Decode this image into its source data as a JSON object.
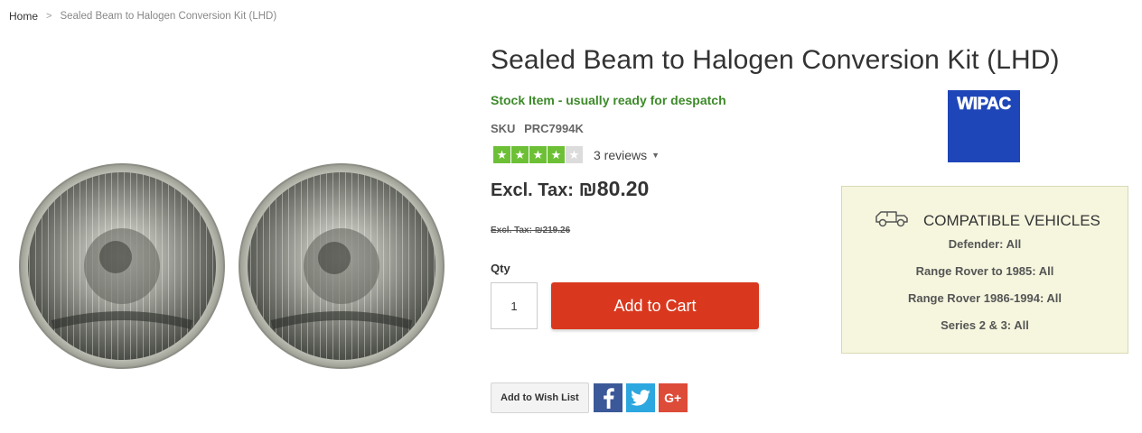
{
  "breadcrumb": {
    "home": "Home",
    "separator": ">",
    "current": "Sealed Beam to Halogen Conversion Kit (LHD)"
  },
  "product": {
    "title": "Sealed Beam to Halogen Conversion Kit (LHD)",
    "stock_status": "Stock Item - usually ready for despatch",
    "sku_label": "SKU",
    "sku_value": "PRC7994K",
    "rating": {
      "stars_filled": 4,
      "stars_total": 5,
      "reviews_text": "3 reviews"
    },
    "price_label": "Excl. Tax:",
    "price_value": "₪80.20",
    "old_price": "Excl. Tax: ₪219.26",
    "image_icon": "headlamp-pair-image"
  },
  "purchase": {
    "qty_label": "Qty",
    "qty_value": "1",
    "add_to_cart": "Add to Cart"
  },
  "actions": {
    "wishlist": "Add to Wish List",
    "facebook_icon": "facebook-icon",
    "twitter_icon": "twitter-icon",
    "googleplus_label": "G+"
  },
  "brand": {
    "logo_text": "WIPAC"
  },
  "compatibility": {
    "title": "COMPATIBLE VEHICLES",
    "icon": "vehicle-icon",
    "items": [
      "Defender: All",
      "Range Rover to 1985: All",
      "Range Rover 1986-1994: All",
      "Series 2 & 3: All"
    ]
  },
  "colors": {
    "accent_red": "#d9381e",
    "stock_green": "#3d8a2a",
    "star_green": "#6dc036",
    "brand_blue": "#1f46b8",
    "compat_bg": "#f6f6df"
  }
}
